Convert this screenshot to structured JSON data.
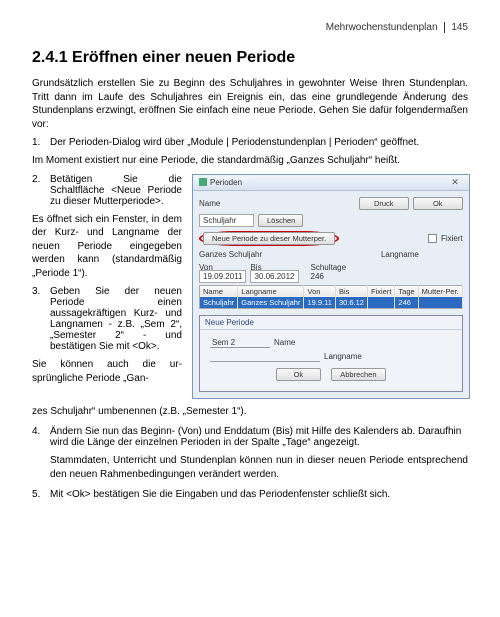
{
  "header": {
    "section": "Mehrwochenstundenplan",
    "page": "145"
  },
  "title": "2.4.1 Eröffnen einer neuen Periode",
  "intro": "Grundsätzlich erstellen Sie zu Beginn des Schuljahres in gewohnter Weise Ihren Stundenplan. Tritt dann im Laufe des Schuljahres ein Ereignis ein, das eine grundlegende Änderung des Stundenplans erzwingt, eröffnen Sie einfach eine neue Periode. Gehen Sie dafür folgendermaßen vor:",
  "steps": {
    "s1_num": "1.",
    "s1": "Der Perioden-Dialog wird über „Module | Periodenstundenplan | Perioden“ geöffnet.",
    "s1_note": "Im Moment existiert nur eine Periode, die standardmäßig „Ganzes Schuljahr“ heißt.",
    "s2_num": "2.",
    "s2": "Betätigen Sie die Schaltfläche <Neue Periode zu dieser Mutterperiode>.",
    "s2_note": "Es öffnet sich ein Fenster, in dem der Kurz- und Langname der neuen Periode eingegeben werden kann (standardmäßig „Periode 1“).",
    "s3_num": "3.",
    "s3": "Geben Sie der neuen Periode einen aussagekräftigen Kurz- und Langnamen - z.B. „Sem 2“, „Semester 2“ - und bestätigen Sie mit <Ok>.",
    "s3_note": "Sie können auch die ursprüngliche Periode „Ganzes Schuljahr“ umbenennen (z.B. „Semester 1“).",
    "s4_num": "4.",
    "s4": "Ändern Sie nun das Beginn- (Von) und Enddatum (Bis) mit Hilfe des Kalenders ab. Daraufhin wird die Länge der einzelnen Perioden in der Spalte „Tage“ angezeigt.",
    "s4_note": "Stammdaten, Unterricht und Stundenplan können nun in dieser neuen Periode entsprechend den neuen Rahmenbedingungen verändert werden.",
    "s5_num": "5.",
    "s5": "Mit <Ok> bestätigen Sie die Eingaben und das Periodenfenster schließt sich."
  },
  "dialog": {
    "title": "Perioden",
    "lbl_name": "Name",
    "lbl_schuljahr": "Schuljahr",
    "btn_loeschen": "Löschen",
    "btn_druck": "Druck",
    "btn_ok": "Ok",
    "btn_neue": "Neue Periode zu dieser Mutterper.",
    "lbl_fixiert": "Fixiert",
    "lbl_ganzes": "Ganzes Schuljahr",
    "lbl_langname": "Langname",
    "lbl_von": "Von",
    "val_von": "19.09.2011",
    "lbl_bis": "Bis",
    "val_bis": "30.06.2012",
    "lbl_schultage": "Schultage",
    "val_schultage": "246",
    "table": {
      "headers": [
        "Name",
        "Langname",
        "Von",
        "Bis",
        "Fixiert",
        "Tage",
        "Mutter-Per."
      ],
      "row": [
        "Schuljahr",
        "Ganzes Schuljahr",
        "19.9.11",
        "30.6.12",
        "",
        "246",
        ""
      ]
    },
    "sub": {
      "title": "Neue Periode",
      "val_name": "Sem 2",
      "lbl_name": "Name",
      "lbl_langname": "Langname",
      "btn_ok": "Ok",
      "btn_abbr": "Abbrechen"
    }
  }
}
